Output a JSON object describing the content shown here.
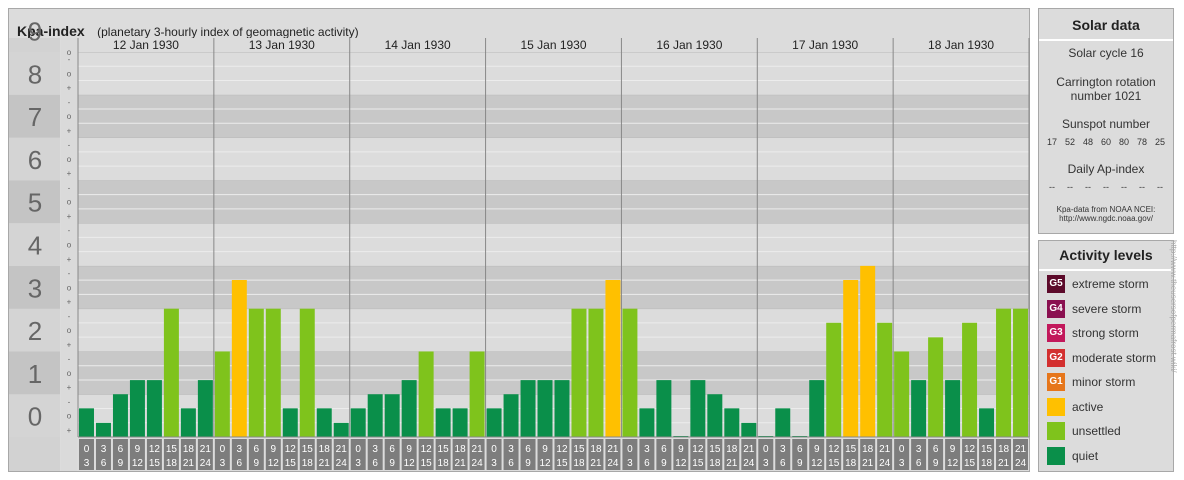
{
  "header": {
    "title": "Kpa-index",
    "subtitle": "(planetary 3-hourly index of geomagnetic activity)"
  },
  "solar": {
    "title": "Solar data",
    "cycle_text": "Solar cycle 16",
    "carrington_line1": "Carrington rotation",
    "carrington_line2": "number 1021",
    "sunspot_label": "Sunspot number",
    "sunspot_values": [
      "17",
      "52",
      "48",
      "60",
      "80",
      "78",
      "25"
    ],
    "ap_label": "Daily Ap-index",
    "ap_values": [
      "--",
      "--",
      "--",
      "--",
      "--",
      "--",
      "--"
    ],
    "source_line1": "Kpa-data from NOAA NCEI:",
    "source_line2": "http://www.ngdc.noaa.gov/"
  },
  "activity": {
    "title": "Activity levels",
    "levels": [
      {
        "badge": "G5",
        "label": "extreme storm",
        "color": "#5c0a2a"
      },
      {
        "badge": "G4",
        "label": "severe storm",
        "color": "#8a1050"
      },
      {
        "badge": "G3",
        "label": "strong storm",
        "color": "#c2185b"
      },
      {
        "badge": "G2",
        "label": "moderate storm",
        "color": "#d32f2f"
      },
      {
        "badge": "G1",
        "label": "minor storm",
        "color": "#e6761b"
      },
      {
        "badge": "",
        "label": "active",
        "color": "#ffc000"
      },
      {
        "badge": "",
        "label": "unsettled",
        "color": "#7fc31c"
      },
      {
        "badge": "",
        "label": "quiet",
        "color": "#0a8f4a"
      }
    ]
  },
  "watermark": "http://www.theusersofpermafrost.wiki/",
  "chart_data": {
    "type": "bar",
    "ylim": [
      0,
      9
    ],
    "y_major_ticks": [
      "0",
      "1",
      "2",
      "3",
      "4",
      "5",
      "6",
      "7",
      "8",
      "9"
    ],
    "y_minor_ticks": [
      "+",
      "o",
      "-"
    ],
    "days": [
      "12 Jan 1930",
      "13 Jan 1930",
      "14 Jan 1930",
      "15 Jan 1930",
      "16 Jan 1930",
      "17 Jan 1930",
      "18 Jan 1930"
    ],
    "interval_labels": [
      [
        "0",
        "3"
      ],
      [
        "3",
        "6"
      ],
      [
        "6",
        "9"
      ],
      [
        "9",
        "12"
      ],
      [
        "12",
        "15"
      ],
      [
        "15",
        "18"
      ],
      [
        "18",
        "21"
      ],
      [
        "21",
        "24"
      ]
    ],
    "values": [
      [
        0.67,
        0.33,
        1.0,
        1.33,
        1.33,
        3.0,
        0.67,
        1.33
      ],
      [
        2.0,
        3.67,
        3.0,
        3.0,
        0.67,
        3.0,
        0.67,
        0.33
      ],
      [
        0.67,
        1.0,
        1.0,
        1.33,
        2.0,
        0.67,
        0.67,
        2.0
      ],
      [
        0.67,
        1.0,
        1.33,
        1.33,
        1.33,
        3.0,
        3.0,
        3.67
      ],
      [
        3.0,
        0.67,
        1.33,
        0.0,
        1.33,
        1.0,
        0.67,
        0.33
      ],
      [
        0.0,
        0.67,
        0.0,
        1.33,
        2.67,
        3.67,
        4.0,
        2.67
      ],
      [
        2.0,
        1.33,
        2.33,
        1.33,
        2.67,
        0.67,
        3.0,
        3.0
      ]
    ],
    "colors": {
      "quiet": "#0a8f4a",
      "unsettled": "#7fc31c",
      "active": "#ffc000"
    }
  }
}
